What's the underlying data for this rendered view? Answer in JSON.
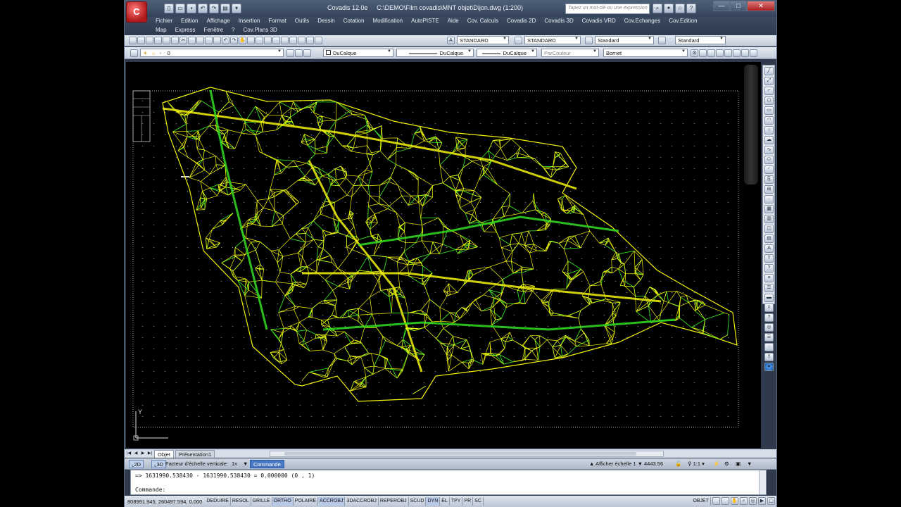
{
  "window": {
    "app_title": "Covadis 12.0e",
    "file_path": "C:\\DEMO\\Film covadis\\MNT objet\\Dijon.dwg (1:200)",
    "search_placeholder": "Tapez un mot-clé ou une expression",
    "close_glyph": "✕",
    "minimize_glyph": "—",
    "restore_glyph": "□"
  },
  "menus": {
    "row1": [
      "Fichier",
      "Edition",
      "Affichage",
      "Insertion",
      "Format",
      "Outils",
      "Dessin",
      "Cotation",
      "Modification",
      "AutoPISTE",
      "Aide",
      "Cov. Calculs",
      "Covadis 2D",
      "Covadis 3D",
      "Covadis VRD",
      "Cov.Echanges",
      "Cov.Edition"
    ],
    "row2": [
      "Map",
      "Express",
      "Fenêtre",
      "?",
      "Cov.Plans 3D"
    ]
  },
  "styles_toolbar": {
    "text_style": "STANDARD",
    "dim_style": "STANDARD",
    "table_style": "Standard",
    "mleader_style": "Standard"
  },
  "layers_toolbar": {
    "current_layer": "0",
    "color": "DuCalque",
    "linetype": "DuCalque",
    "lineweight": "DuCalque",
    "plotstyle": "ParCouleur",
    "layer_filter": "Bornet"
  },
  "tabs": {
    "model": "Objet",
    "layout": "Présentation1"
  },
  "scale_bar": {
    "btn_2d": "2D",
    "btn_3d": "3D",
    "label": "Facteur d'échelle verticale:",
    "value": "1x",
    "command_label": "Commande",
    "annotation_label": "Afficher échelle 1",
    "scale_value": "4443.56",
    "ratio": "1:1"
  },
  "command": {
    "history": "=> 1631990.538430 - 1631990.538430 = 0.000000 (0 , 1)",
    "prompt": "Commande:"
  },
  "status": {
    "coords": "808991.945, 260497.594, 0.000",
    "toggles": [
      "DEDUIRE",
      "RESOL",
      "GRILLE",
      "ORTHO",
      "POLAIRE",
      "ACCROBJ",
      "3DACCROBJ",
      "REPEROBJ",
      "SCUD",
      "DYN",
      "EL",
      "TPY",
      "PR",
      "SC"
    ],
    "space": "OBJET"
  },
  "colors": {
    "mesh_primary": "#f2f20a",
    "mesh_secondary": "#33dd22",
    "background": "#000000",
    "grid_dots": "#8a8a8a"
  }
}
